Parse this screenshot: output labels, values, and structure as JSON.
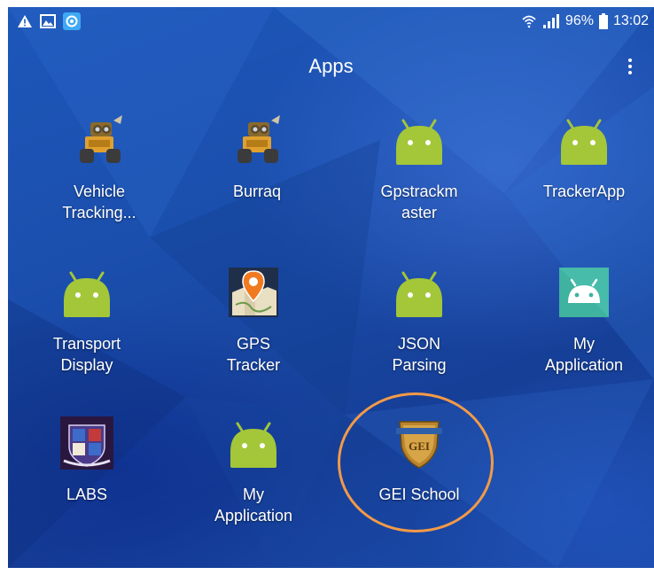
{
  "status_bar": {
    "battery": "96%",
    "time": "13:02",
    "icons": [
      "warning-icon",
      "image-icon",
      "sync-app-icon",
      "wifi-icon",
      "signal-icon",
      "battery-icon"
    ]
  },
  "title_bar": {
    "title": "Apps",
    "menu_icon": "more-vert-icon"
  },
  "apps": [
    {
      "id": "vehicle-tracking",
      "label_lines": [
        "Vehicle",
        "Tracking..."
      ],
      "icon": "robot-icon"
    },
    {
      "id": "burraq",
      "label_lines": [
        "Burraq"
      ],
      "icon": "robot-icon"
    },
    {
      "id": "gpstrackmaster",
      "label_lines": [
        "Gpstrackm",
        "aster"
      ],
      "icon": "android-icon"
    },
    {
      "id": "trackerapp",
      "label_lines": [
        "TrackerApp"
      ],
      "icon": "android-icon"
    },
    {
      "id": "transport-display",
      "label_lines": [
        "Transport",
        "Display"
      ],
      "icon": "android-icon"
    },
    {
      "id": "gps-tracker",
      "label_lines": [
        "GPS",
        "Tracker"
      ],
      "icon": "map-pin-icon"
    },
    {
      "id": "json-parsing",
      "label_lines": [
        "JSON",
        "Parsing"
      ],
      "icon": "android-icon"
    },
    {
      "id": "my-application-1",
      "label_lines": [
        "My",
        "Application"
      ],
      "icon": "android-square-icon"
    },
    {
      "id": "labs",
      "label_lines": [
        "LABS"
      ],
      "icon": "crest-icon"
    },
    {
      "id": "my-application-2",
      "label_lines": [
        "My",
        "Application"
      ],
      "icon": "android-icon"
    },
    {
      "id": "gei-school",
      "label_lines": [
        "GEI School"
      ],
      "icon": "shield-icon",
      "badge_text": "GEI"
    }
  ],
  "highlight": {
    "target": "gei-school",
    "color": "#f39a47"
  },
  "colors": {
    "android_green": "#a4c639",
    "wallpaper": "#1b4fae"
  }
}
